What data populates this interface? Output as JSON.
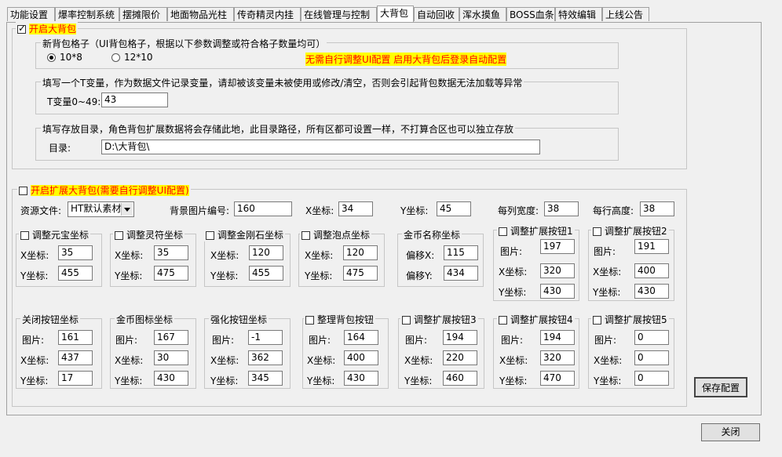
{
  "tabs": [
    "功能设置",
    "爆率控制系统",
    "摆摊限价",
    "地面物品光柱",
    "传奇精灵内挂",
    "在线管理与控制",
    "大背包",
    "自动回收",
    "浑水摸鱼",
    "BOSS血条",
    "特效编辑",
    "上线公告"
  ],
  "enable_bag": {
    "label": "开启大背包",
    "checked": true
  },
  "grid_group": {
    "title": "新背包格子（UI背包格子，根据以下参数调整或符合格子数量均可）",
    "opt1": "10*8",
    "opt2": "12*10",
    "selected": "10*8",
    "note": "无需自行调整UI配置 启用大背包后登录自动配置"
  },
  "tvar_group": {
    "title": "填写一个T变量，作为数据文件记录变量，请却被该变量未被使用或修改/清空，否则会引起背包数据无法加载等异常",
    "label": "T变量0~49:",
    "value": "43"
  },
  "dir_group": {
    "title": "填写存放目录，角色背包扩展数据将会存储此地，此目录路径，所有区都可设置一样，不打算合区也可以独立存放",
    "label": "目录:",
    "value": "D:\\大背包\\"
  },
  "enable_ext": {
    "label": "开启扩展大背包(需要自行调整UI配置)",
    "checked": false
  },
  "resource": {
    "label": "资源文件:",
    "value": "HT默认素材"
  },
  "bg_image": {
    "label": "背景图片编号:",
    "value": "160"
  },
  "x_coord": {
    "label": "X坐标:",
    "value": "34"
  },
  "y_coord": {
    "label": "Y坐标:",
    "value": "45"
  },
  "col_width": {
    "label": "每列宽度:",
    "value": "38"
  },
  "row_height": {
    "label": "每行高度:",
    "value": "38"
  },
  "labels": {
    "x": "X坐标:",
    "y": "Y坐标:",
    "img": "图片:",
    "ox": "偏移X:",
    "oy": "偏移Y:"
  },
  "row1": [
    {
      "title": "调整元宝坐标",
      "check": true,
      "x": "35",
      "y": "455"
    },
    {
      "title": "调整灵符坐标",
      "check": true,
      "x": "35",
      "y": "475"
    },
    {
      "title": "调整金刚石坐标",
      "check": true,
      "x": "120",
      "y": "455"
    },
    {
      "title": "调整泡点坐标",
      "check": true,
      "x": "120",
      "y": "475"
    },
    {
      "title": "金币名称坐标",
      "check": false,
      "x": "115",
      "y": "434"
    }
  ],
  "row1_buttons": [
    {
      "title": "调整扩展按钮1",
      "img": "197",
      "x": "320",
      "y": "430"
    },
    {
      "title": "调整扩展按钮2",
      "img": "191",
      "x": "400",
      "y": "430"
    }
  ],
  "row2": [
    {
      "title": "关闭按钮坐标",
      "check": false,
      "img": "161",
      "x": "437",
      "y": "17"
    },
    {
      "title": "金币图标坐标",
      "check": false,
      "img": "167",
      "x": "30",
      "y": "430"
    },
    {
      "title": "强化按钮坐标",
      "check": false,
      "img": "-1",
      "x": "362",
      "y": "345"
    },
    {
      "title": "整理背包按钮",
      "check": true,
      "img": "164",
      "x": "400",
      "y": "430"
    },
    {
      "title": "调整扩展按钮3",
      "check": true,
      "img": "194",
      "x": "220",
      "y": "460"
    },
    {
      "title": "调整扩展按钮4",
      "check": true,
      "img": "194",
      "x": "320",
      "y": "470"
    },
    {
      "title": "调整扩展按钮5",
      "check": true,
      "img": "0",
      "x": "0",
      "y": "0"
    }
  ],
  "save_button": "保存配置",
  "close_button": "关闭"
}
